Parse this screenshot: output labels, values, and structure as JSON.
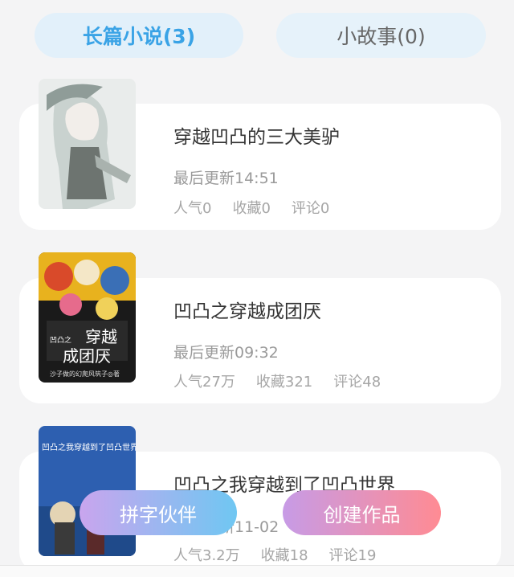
{
  "tabs": {
    "novel": "长篇小说(3)",
    "story": "小故事(0)"
  },
  "works": [
    {
      "title": "穿越凹凸的三大美驴",
      "updated": "最后更新14:51",
      "popularity": "人气0",
      "favorites": "收藏0",
      "comments": "评论0"
    },
    {
      "title": "凹凸之穿越成团厌",
      "updated": "最后更新09:32",
      "popularity": "人气27万",
      "favorites": "收藏321",
      "comments": "评论48",
      "cover_text": [
        "凹凸之",
        "穿越",
        "成团厌",
        "沙子做的幻爬风筑子◎著"
      ]
    },
    {
      "title": "凹凸之我穿越到了凹凸世界",
      "updated": "最后更新11-02",
      "popularity": "人气3.2万",
      "favorites": "收藏18",
      "comments": "评论19",
      "cover_text": [
        "凹凸之我穿越到了凹凸世界"
      ]
    }
  ],
  "actions": {
    "partner": "拼字伙伴",
    "create": "创建作品"
  },
  "colors": {
    "accent": "#3aa3e6",
    "tab_bg": "#e2f0fa"
  }
}
